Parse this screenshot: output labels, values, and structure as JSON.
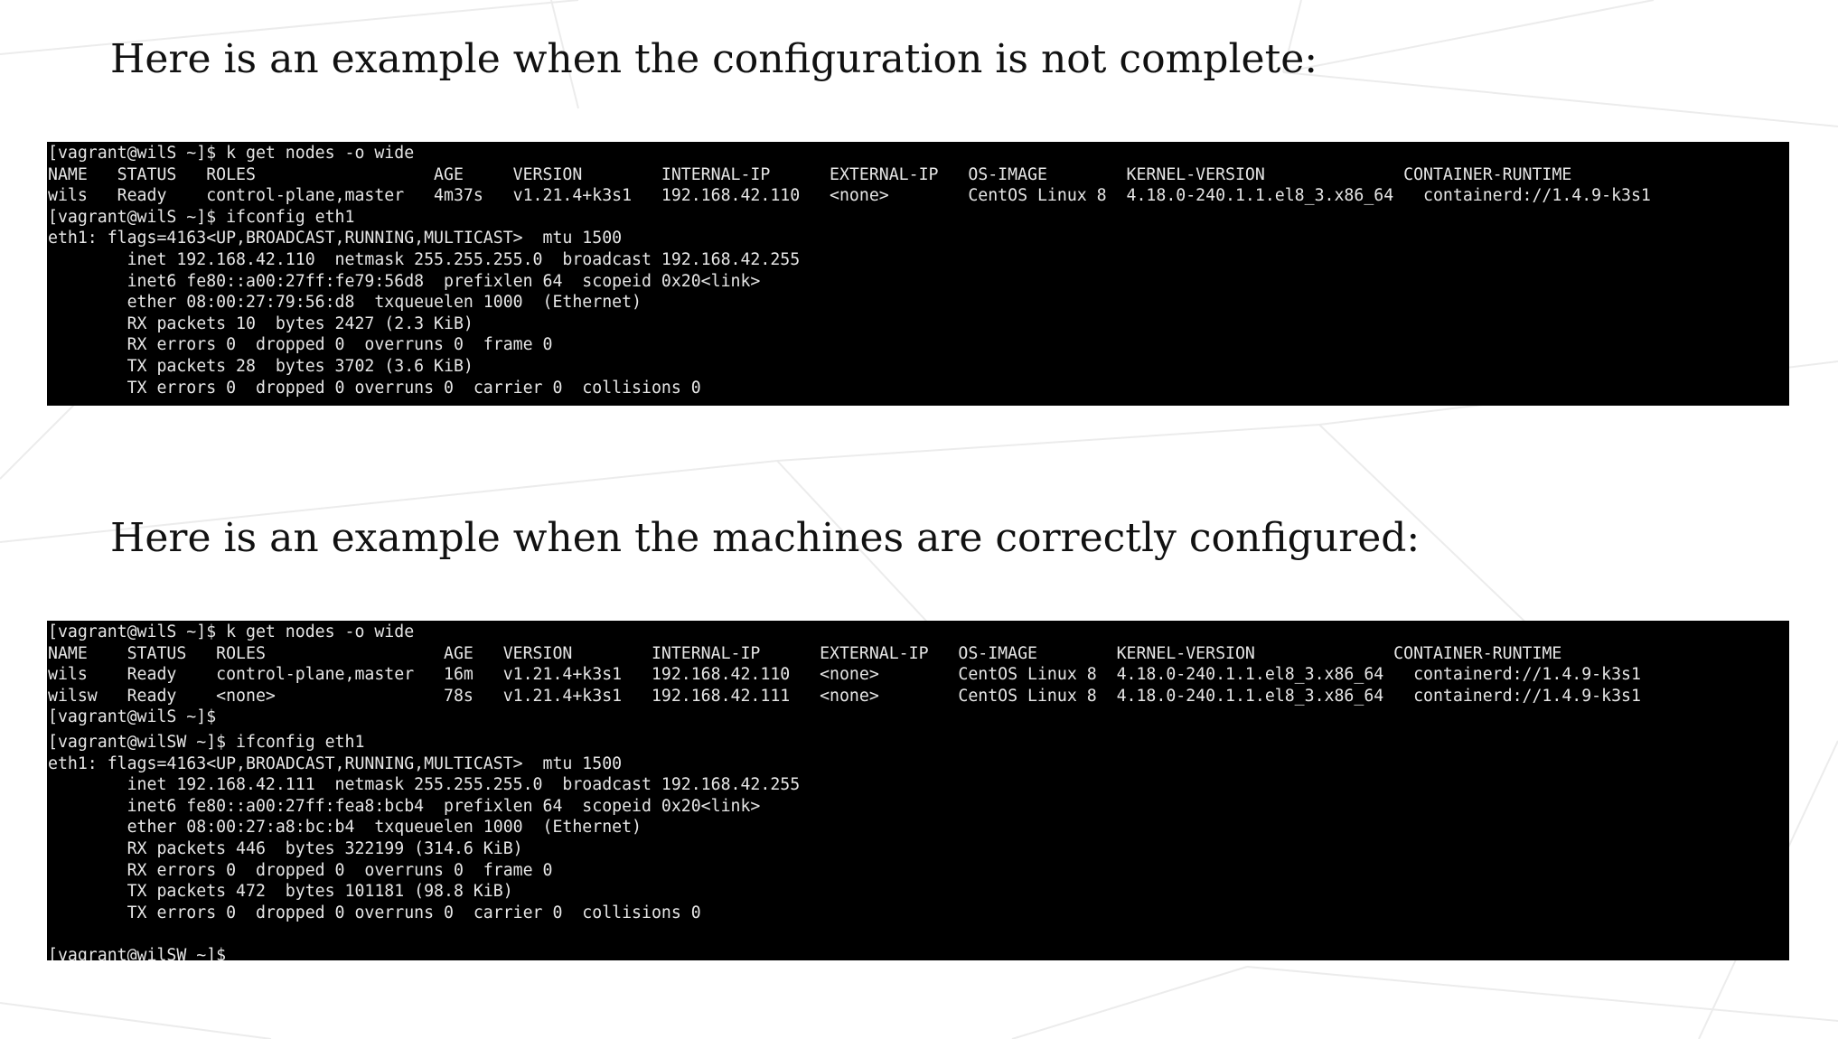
{
  "headings": {
    "incomplete": "Here is an example when the configuration is not complete:",
    "correct": "Here is an example when the machines are correctly configured:"
  },
  "terminal_1": {
    "lines": [
      "[vagrant@wilS ~]$ k get nodes -o wide",
      "NAME   STATUS   ROLES                  AGE     VERSION        INTERNAL-IP      EXTERNAL-IP   OS-IMAGE        KERNEL-VERSION              CONTAINER-RUNTIME",
      "wils   Ready    control-plane,master   4m37s   v1.21.4+k3s1   192.168.42.110   <none>        CentOS Linux 8  4.18.0-240.1.1.el8_3.x86_64   containerd://1.4.9-k3s1",
      "[vagrant@wilS ~]$ ifconfig eth1",
      "eth1: flags=4163<UP,BROADCAST,RUNNING,MULTICAST>  mtu 1500",
      "        inet 192.168.42.110  netmask 255.255.255.0  broadcast 192.168.42.255",
      "        inet6 fe80::a00:27ff:fe79:56d8  prefixlen 64  scopeid 0x20<link>",
      "        ether 08:00:27:79:56:d8  txqueuelen 1000  (Ethernet)",
      "        RX packets 10  bytes 2427 (2.3 KiB)",
      "        RX errors 0  dropped 0  overruns 0  frame 0",
      "        TX packets 28  bytes 3702 (3.6 KiB)",
      "        TX errors 0  dropped 0 overruns 0  carrier 0  collisions 0"
    ]
  },
  "terminal_2": {
    "nodes_lines": [
      "[vagrant@wilS ~]$ k get nodes -o wide",
      "NAME    STATUS   ROLES                  AGE   VERSION        INTERNAL-IP      EXTERNAL-IP   OS-IMAGE        KERNEL-VERSION              CONTAINER-RUNTIME",
      "wils    Ready    control-plane,master   16m   v1.21.4+k3s1   192.168.42.110   <none>        CentOS Linux 8  4.18.0-240.1.1.el8_3.x86_64   containerd://1.4.9-k3s1",
      "wilsw   Ready    <none>                 78s   v1.21.4+k3s1   192.168.42.111   <none>        CentOS Linux 8  4.18.0-240.1.1.el8_3.x86_64   containerd://1.4.9-k3s1",
      "[vagrant@wilS ~]$"
    ],
    "ifconfig_lines": [
      "[vagrant@wilSW ~]$ ifconfig eth1",
      "eth1: flags=4163<UP,BROADCAST,RUNNING,MULTICAST>  mtu 1500",
      "        inet 192.168.42.111  netmask 255.255.255.0  broadcast 192.168.42.255",
      "        inet6 fe80::a00:27ff:fea8:bcb4  prefixlen 64  scopeid 0x20<link>",
      "        ether 08:00:27:a8:bc:b4  txqueuelen 1000  (Ethernet)",
      "        RX packets 446  bytes 322199 (314.6 KiB)",
      "        RX errors 0  dropped 0  overruns 0  frame 0",
      "        TX packets 472  bytes 101181 (98.8 KiB)",
      "        TX errors 0  dropped 0 overruns 0  carrier 0  collisions 0"
    ],
    "final_prompt": "[vagrant@wilSW ~]$"
  }
}
